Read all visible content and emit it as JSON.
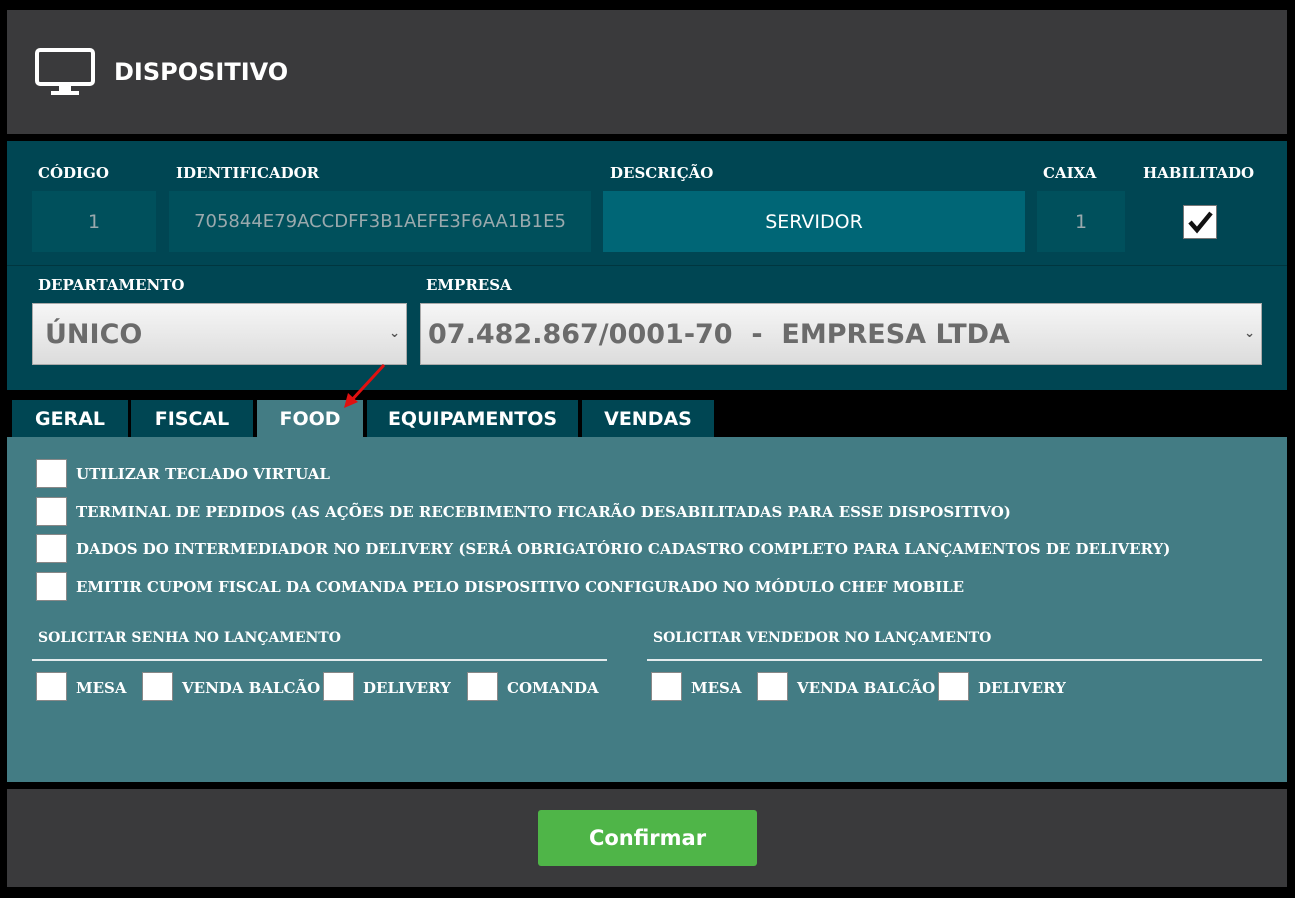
{
  "header": {
    "title": "DISPOSITIVO",
    "icon": "monitor-icon"
  },
  "fields": {
    "codigo_label": "CÓDIGO",
    "codigo_value": "1",
    "identificador_label": "IDENTIFICADOR",
    "identificador_value": "705844E79ACCDFF3B1AEFE3F6AA1B1E5",
    "descricao_label": "DESCRIÇÃO",
    "descricao_value": "SERVIDOR",
    "caixa_label": "CAIXA",
    "caixa_value": "1",
    "habilitado_label": "HABILITADO",
    "habilitado_checked": true,
    "departamento_label": "DEPARTAMENTO",
    "departamento_value": "ÚNICO",
    "empresa_label": "EMPRESA",
    "empresa_value": "07.482.867/0001-70  -  EMPRESA LTDA"
  },
  "tabs": [
    {
      "label": "GERAL",
      "active": false
    },
    {
      "label": "FISCAL",
      "active": false
    },
    {
      "label": "FOOD",
      "active": true
    },
    {
      "label": "EQUIPAMENTOS",
      "active": false
    },
    {
      "label": "VENDAS",
      "active": false
    }
  ],
  "food": {
    "options": [
      "UTILIZAR TECLADO VIRTUAL",
      "TERMINAL DE PEDIDOS (AS AÇÕES DE RECEBIMENTO FICARÃO DESABILITADAS PARA ESSE DISPOSITIVO)",
      "DADOS DO INTERMEDIADOR NO DELIVERY (SERÁ OBRIGATÓRIO CADASTRO COMPLETO PARA LANÇAMENTOS DE DELIVERY)",
      "EMITIR CUPOM FISCAL DA COMANDA PELO DISPOSITIVO CONFIGURADO NO MÓDULO CHEF MOBILE"
    ],
    "senha_title": "SOLICITAR SENHA NO LANÇAMENTO",
    "senha_options": [
      "MESA",
      "VENDA BALCÃO",
      "DELIVERY",
      "COMANDA"
    ],
    "vendedor_title": "SOLICITAR VENDEDOR NO LANÇAMENTO",
    "vendedor_options": [
      "MESA",
      "VENDA BALCÃO",
      "DELIVERY"
    ]
  },
  "footer": {
    "confirm_label": "Confirmar"
  },
  "colors": {
    "panel": "#004653",
    "tab_body": "#437c84",
    "confirm": "#4fb548",
    "annotation_arrow": "#e01010"
  }
}
